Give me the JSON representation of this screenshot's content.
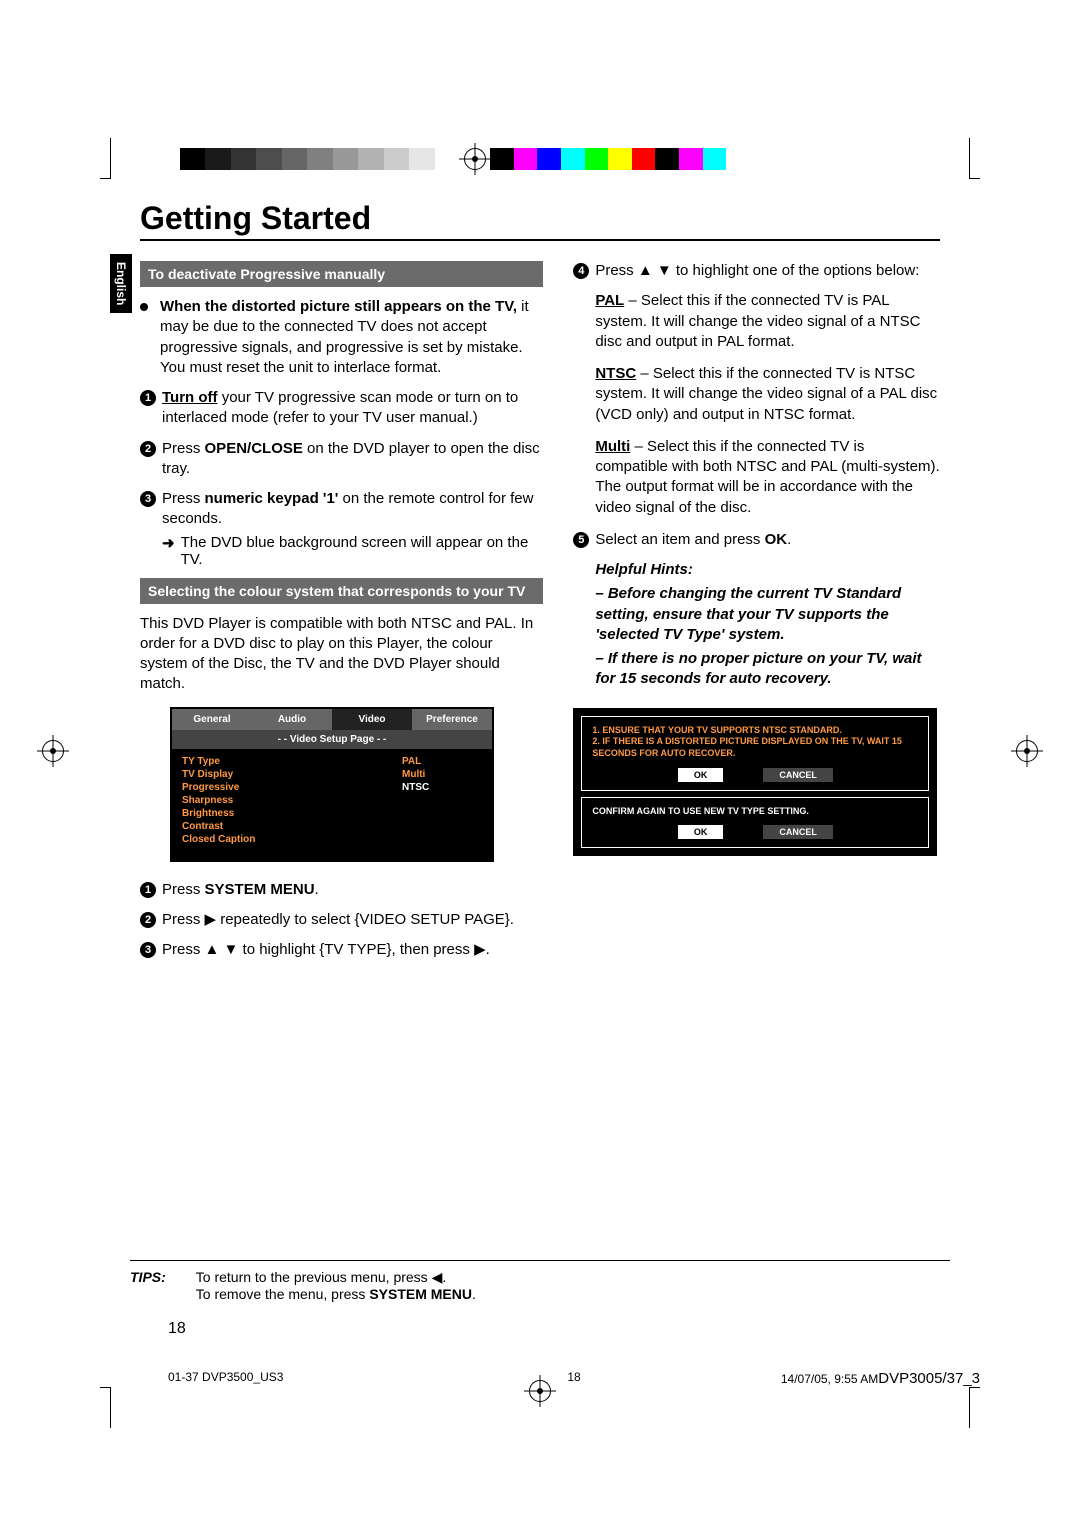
{
  "side_tab": "English",
  "title": "Getting Started",
  "sections": {
    "deactivate": "To deactivate Progressive manually",
    "colour": "Selecting the colour system that corresponds to your TV"
  },
  "left": {
    "intro_bold": "When the distorted picture still appears on the TV,",
    "intro_rest": " it may be due to the connected TV does not accept progressive signals, and progressive is set by mistake.  You must reset the unit to interlace format.",
    "step1a": "Turn off",
    "step1b": " your TV progressive scan mode or turn on to interlaced mode (refer to your TV user manual.)",
    "step2a": "Press ",
    "step2b": "OPEN/CLOSE",
    "step2c": " on the DVD player to open the disc tray.",
    "step3a": "Press ",
    "step3b": "numeric keypad '1'",
    "step3c": " on the remote control for few seconds.",
    "step3_arrow": "The DVD blue background screen will appear on the TV.",
    "colour_p": "This DVD Player is compatible with both NTSC and PAL. In order for a DVD disc to play on this Player, the colour system of the Disc, the TV and the DVD Player should match.",
    "m_step1a": "Press ",
    "m_step1b": "SYSTEM MENU",
    "m_step2": "Press ▶ repeatedly to select {VIDEO SETUP PAGE}.",
    "m_step3": "Press ▲ ▼ to highlight {TV TYPE}, then press ▶."
  },
  "right": {
    "step4": "Press ▲ ▼ to highlight one of the options below:",
    "pal_b": "PAL",
    "pal_t": " – Select this if the connected TV is PAL system. It will change the video signal of a NTSC disc and output in PAL format.",
    "ntsc_b": "NTSC",
    "ntsc_t": " – Select this if the connected TV is NTSC system. It will change the video signal of a PAL disc (VCD only) and output in NTSC format.",
    "multi_b": "Multi",
    "multi_t": " – Select this if the connected TV is compatible with both NTSC and PAL (multi-system).  The output format will be in accordance with the video signal of the disc.",
    "step5a": "Select an item and press ",
    "step5b": "OK",
    "hints_h": "Helpful Hints:",
    "hint1": "–   Before changing the current TV Standard setting, ensure that your TV supports the 'selected TV Type' system.",
    "hint2": "–   If there is no proper picture on your TV, wait for 15 seconds for auto recovery."
  },
  "menu": {
    "tabs": [
      "General",
      "Audio",
      "Video",
      "Preference"
    ],
    "header": "- -   Video Setup Page   - -",
    "rows": [
      {
        "lbl": "TY Type",
        "val": "PAL"
      },
      {
        "lbl": "TV Display",
        "val": "Multi"
      },
      {
        "lbl": "Progressive",
        "val": "NTSC"
      },
      {
        "lbl": "Sharpness",
        "val": ""
      },
      {
        "lbl": "Brightness",
        "val": ""
      },
      {
        "lbl": "Contrast",
        "val": ""
      },
      {
        "lbl": "Closed Caption",
        "val": ""
      }
    ]
  },
  "dialog": {
    "line1": "1. ENSURE THAT YOUR TV SUPPORTS NTSC STANDARD.",
    "line2": "2. IF THERE IS A DISTORTED PICTURE DISPLAYED ON THE TV, WAIT 15 SECONDS FOR AUTO RECOVER.",
    "ok": "OK",
    "cancel": "CANCEL",
    "confirm": "CONFIRM AGAIN TO USE NEW TV TYPE SETTING."
  },
  "tips": {
    "label": "TIPS:",
    "line1a": "To return to the previous menu, press ◀.",
    "line2a": "To remove the menu, press ",
    "line2b": "SYSTEM MENU",
    "line2c": "."
  },
  "page_number": "18",
  "footer": {
    "left": "01-37 DVP3500_US3",
    "mid": "18",
    "right_time": "14/07/05, 9:55 AM",
    "right_model": "DVP3005/37_3"
  },
  "color_bar_colors": [
    "#000",
    "#f0f",
    "#00f",
    "#0ff",
    "#0f0",
    "#ff0",
    "#f00",
    "#000",
    "#f0f",
    "#0ff",
    "#fff"
  ],
  "gray_bar_colors": [
    "#000",
    "#1a1a1a",
    "#333",
    "#4d4d4d",
    "#666",
    "#808080",
    "#999",
    "#b3b3b3",
    "#ccc",
    "#e6e6e6",
    "#fff"
  ]
}
